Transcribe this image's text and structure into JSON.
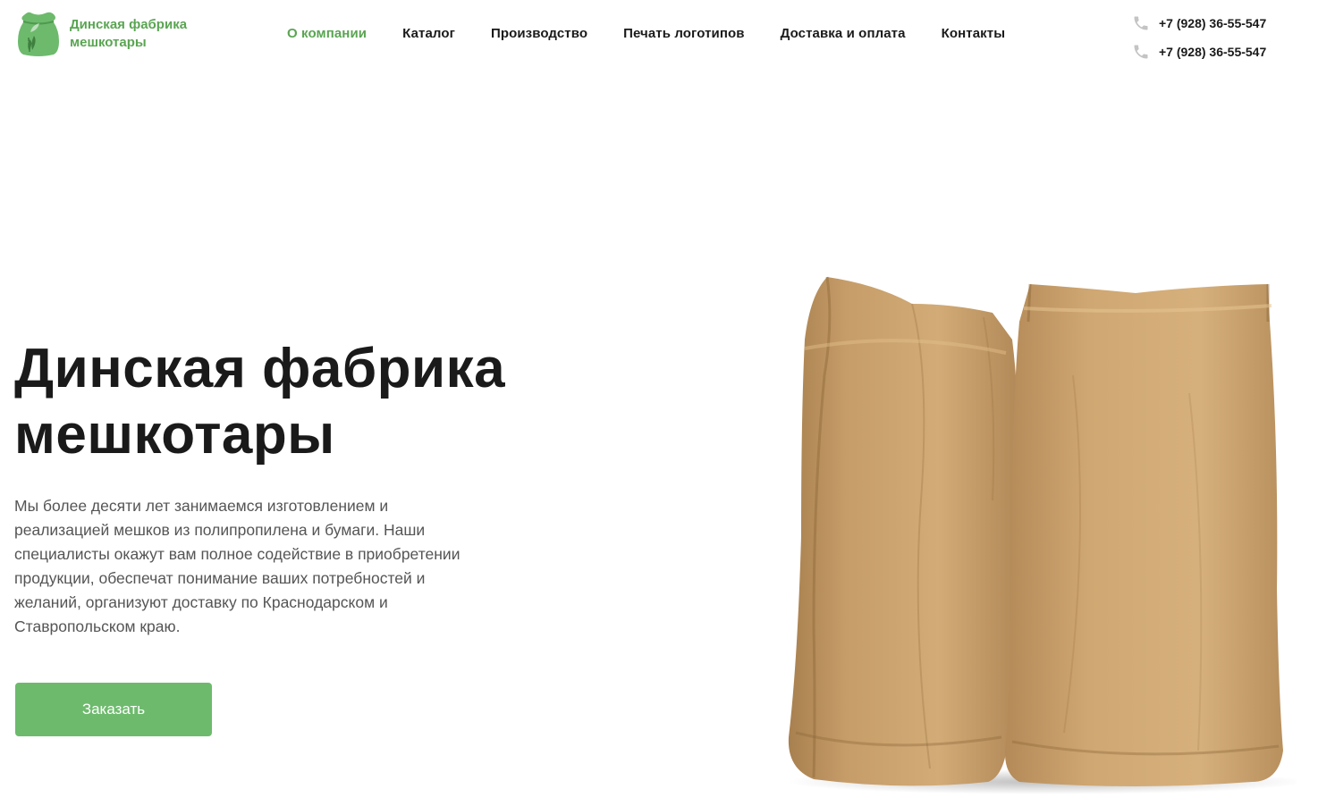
{
  "logo": {
    "text": "Динская фабрика мешкотары"
  },
  "nav": {
    "items": [
      {
        "label": "О компании",
        "active": true
      },
      {
        "label": "Каталог"
      },
      {
        "label": "Производство"
      },
      {
        "label": "Печать логотипов"
      },
      {
        "label": "Доставка и оплата"
      },
      {
        "label": "Контакты"
      }
    ]
  },
  "phones": [
    "+7 (928) 36-55-547",
    "+7 (928) 36-55-547"
  ],
  "hero": {
    "title": "Динская фабрика мешкотары",
    "description": "Мы более десяти лет занимаемся изготовлением и реализацией мешков из полипропилена и бумаги. Наши специалисты окажут вам полное содействие в приобретении продукции, обеспечат понимание ваших потребностей и желаний, организуют доставку по Краснодарском и Ставропольском краю.",
    "button": "Заказать"
  },
  "colors": {
    "accent": "#5aa552",
    "button": "#6dba6d",
    "kraft": "#c9a06b"
  },
  "icons": {
    "logo": "sack-leaf-icon",
    "phone": "phone-icon"
  }
}
